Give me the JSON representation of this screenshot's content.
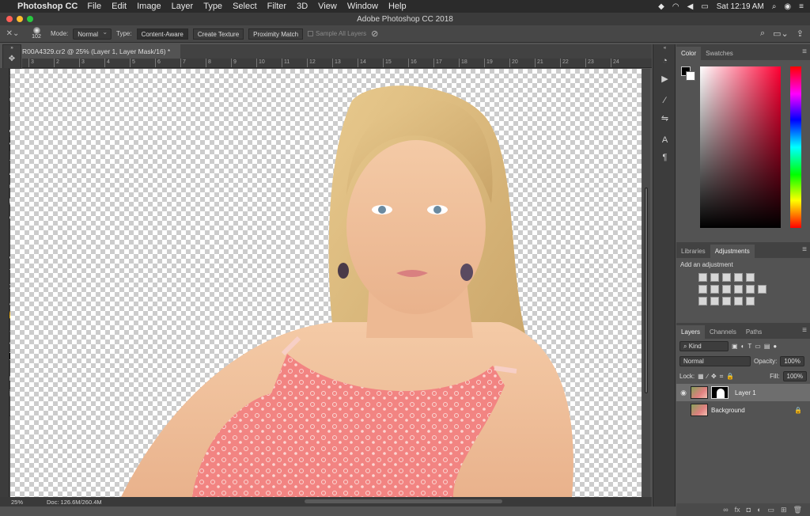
{
  "menubar": {
    "app_name": "Photoshop CC",
    "items": [
      "File",
      "Edit",
      "Image",
      "Layer",
      "Type",
      "Select",
      "Filter",
      "3D",
      "View",
      "Window",
      "Help"
    ],
    "clock": "Sat 12:19 AM"
  },
  "window": {
    "title": "Adobe Photoshop CC 2018"
  },
  "options": {
    "brush_size": "102",
    "mode_label": "Mode:",
    "mode_value": "Normal",
    "type_label": "Type:",
    "type_buttons": [
      "Content-Aware",
      "Create Texture",
      "Proximity Match"
    ],
    "sample_all_layers": "Sample All Layers"
  },
  "document": {
    "tab_title": "R00A4329.cr2 @ 25% (Layer 1, Layer Mask/16) *",
    "ruler_marks": [
      "3",
      "2",
      "3",
      "4",
      "5",
      "6",
      "7",
      "8",
      "9",
      "10",
      "11",
      "12",
      "13",
      "14",
      "15",
      "16",
      "17",
      "18",
      "19",
      "20",
      "21",
      "22",
      "23",
      "24"
    ]
  },
  "status": {
    "zoom": "25%",
    "doc_info": "Doc: 126.6M/260.4M"
  },
  "panels": {
    "color_tabs": [
      "Color",
      "Swatches"
    ],
    "adj_tabs": [
      "Libraries",
      "Adjustments"
    ],
    "adj_title": "Add an adjustment",
    "layer_tabs": [
      "Layers",
      "Channels",
      "Paths"
    ],
    "kind": "Kind",
    "blend_mode": "Normal",
    "opacity_label": "Opacity:",
    "opacity_value": "100%",
    "lock_label": "Lock:",
    "fill_label": "Fill:",
    "fill_value": "100%",
    "layers": [
      {
        "name": "Layer 1"
      },
      {
        "name": "Background"
      }
    ]
  }
}
